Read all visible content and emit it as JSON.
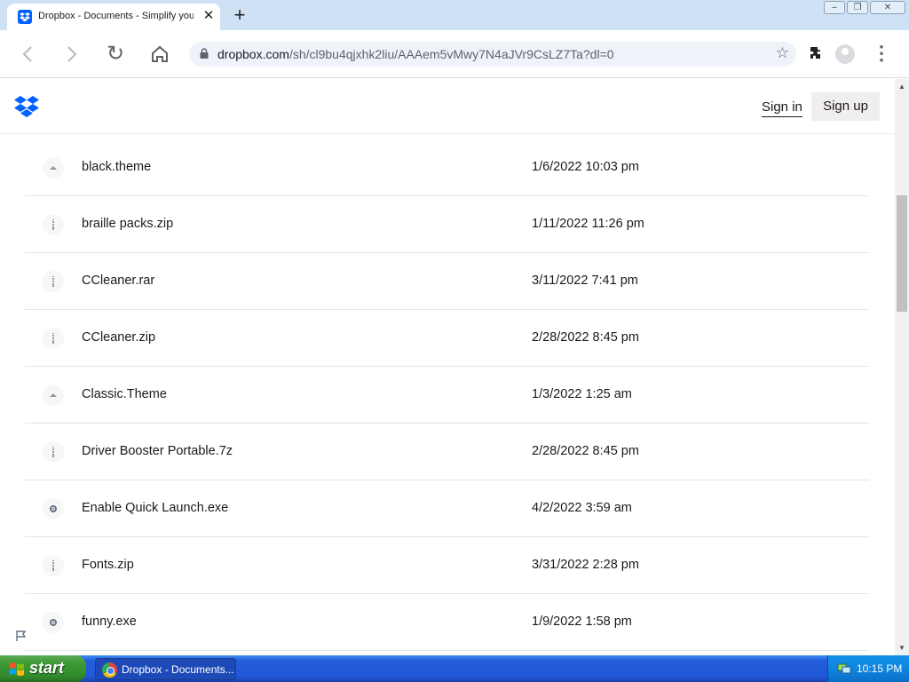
{
  "browser": {
    "tab": {
      "title": "Dropbox - Documents - Simplify your",
      "close_glyph": "✕",
      "favicon": "dropbox-icon"
    },
    "new_tab_glyph": "+",
    "window_buttons": [
      "minimize-icon",
      "restore-icon",
      "close-icon"
    ],
    "nav": {
      "back_glyph": "‹",
      "forward_glyph": "›",
      "reload_glyph": "↻",
      "home": "home-icon"
    },
    "url": {
      "host": "dropbox.com",
      "path": "/sh/cl9bu4qjxhk2liu/AAAem5vMwy7N4aJVr9CsLZ7Ta?dl=0"
    },
    "star_glyph": "☆",
    "extensions_glyph": "✱",
    "menu_glyph": "⋮"
  },
  "header": {
    "logo": "dropbox-logo",
    "sign_in": "Sign in",
    "sign_up": "Sign up"
  },
  "files": [
    {
      "name": "black.theme",
      "date": "1/6/2022 10:03 pm",
      "icon": "theme-file-icon"
    },
    {
      "name": "braille packs.zip",
      "date": "1/11/2022 11:26 pm",
      "icon": "zip-file-icon"
    },
    {
      "name": "CCleaner.rar",
      "date": "3/11/2022 7:41 pm",
      "icon": "zip-file-icon"
    },
    {
      "name": "CCleaner.zip",
      "date": "2/28/2022 8:45 pm",
      "icon": "zip-file-icon"
    },
    {
      "name": "Classic.Theme",
      "date": "1/3/2022 1:25 am",
      "icon": "theme-file-icon"
    },
    {
      "name": "Driver Booster Portable.7z",
      "date": "2/28/2022 8:45 pm",
      "icon": "zip-file-icon"
    },
    {
      "name": "Enable Quick Launch.exe",
      "date": "4/2/2022 3:59 am",
      "icon": "exe-file-icon"
    },
    {
      "name": "Fonts.zip",
      "date": "3/31/2022 2:28 pm",
      "icon": "zip-file-icon"
    },
    {
      "name": "funny.exe",
      "date": "1/9/2022 1:58 pm",
      "icon": "exe-file-icon"
    }
  ],
  "taskbar": {
    "start_label": "start",
    "task_label": "Dropbox - Documents...",
    "clock": "10:15 PM"
  },
  "colors": {
    "dropbox_blue": "#0061fe",
    "xp_taskbar": "#245edb",
    "xp_start": "#3c9a35"
  }
}
